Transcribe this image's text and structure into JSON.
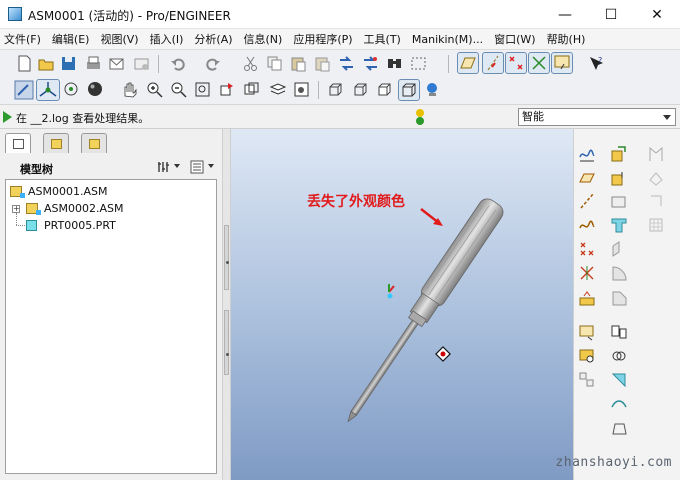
{
  "window": {
    "title": "ASM0001 (活动的) - Pro/ENGINEER",
    "minimize": "—",
    "maximize": "☐",
    "close": "✕"
  },
  "menu": [
    "文件(F)",
    "编辑(E)",
    "视图(V)",
    "插入(I)",
    "分析(A)",
    "信息(N)",
    "应用程序(P)",
    "工具(T)",
    "Manikin(M)...",
    "窗口(W)",
    "帮助(H)"
  ],
  "toolbar_row1": [
    "new-file-icon",
    "open-file-icon",
    "save-icon",
    "print-icon",
    "send-mail-icon",
    "send-attachment-icon",
    "undo-icon",
    "redo-icon",
    "cut-icon",
    "copy-icon",
    "paste-icon",
    "paste-special-icon",
    "regenerate-icon",
    "regen-manager-icon",
    "find-icon",
    "select-box-icon",
    "datum-plane-display-icon",
    "datum-axis-display-icon",
    "point-display-icon",
    "csys-display-icon",
    "annotation-display-icon",
    "context-help-icon"
  ],
  "toolbar_row2": [
    "repaint-icon",
    "spin-center-icon",
    "orient-mode-icon",
    "appearance-sphere-icon",
    "pan-hand-icon",
    "zoom-in-icon",
    "zoom-out-icon",
    "refit-icon",
    "reorient-icon",
    "saved-views-icon",
    "layers-icon",
    "view-manager-icon",
    "wireframe-icon",
    "hidden-line-icon",
    "no-hidden-icon",
    "shading-icon",
    "enhanced-realism-icon"
  ],
  "message": {
    "text": "在 __2.log 查看处理结果。"
  },
  "filter": {
    "value": "智能"
  },
  "model_tree": {
    "header": "模型树",
    "items": [
      {
        "label": "ASM0001.ASM",
        "type": "assembly",
        "level": 0
      },
      {
        "label": "ASM0002.ASM",
        "type": "assembly",
        "level": 1,
        "expandable": true
      },
      {
        "label": "PRT0005.PRT",
        "type": "part",
        "level": 1
      }
    ]
  },
  "graphics": {
    "annotation": "丢失了外观颜色",
    "annotation_color": "#e11b1b",
    "background_top": "#dfe8f5",
    "background_bottom": "#7f9ac4",
    "model_color": "#c9c9c9"
  },
  "right_toolbar": [
    "sketch-tool-icon",
    "datum-plane-tool-icon",
    "datum-axis-tool-icon",
    "datum-curve-tool-icon",
    "datum-point-tool-icon",
    "csys-tool-icon",
    "analysis-feature-icon",
    "assemble-component-icon",
    "create-component-icon",
    "extrude-icon",
    "revolve-icon",
    "sweep-icon",
    "blend-icon",
    "hole-icon",
    "round-icon",
    "chamfer-icon",
    "shell-icon",
    "rib-icon",
    "draft-icon",
    "mirror-icon",
    "pattern-icon",
    "merge-icon",
    "trim-icon",
    "offset-icon",
    "thicken-icon",
    "solidify-icon",
    "boundary-blend-icon"
  ],
  "watermark": "zhanshaoyi.com"
}
